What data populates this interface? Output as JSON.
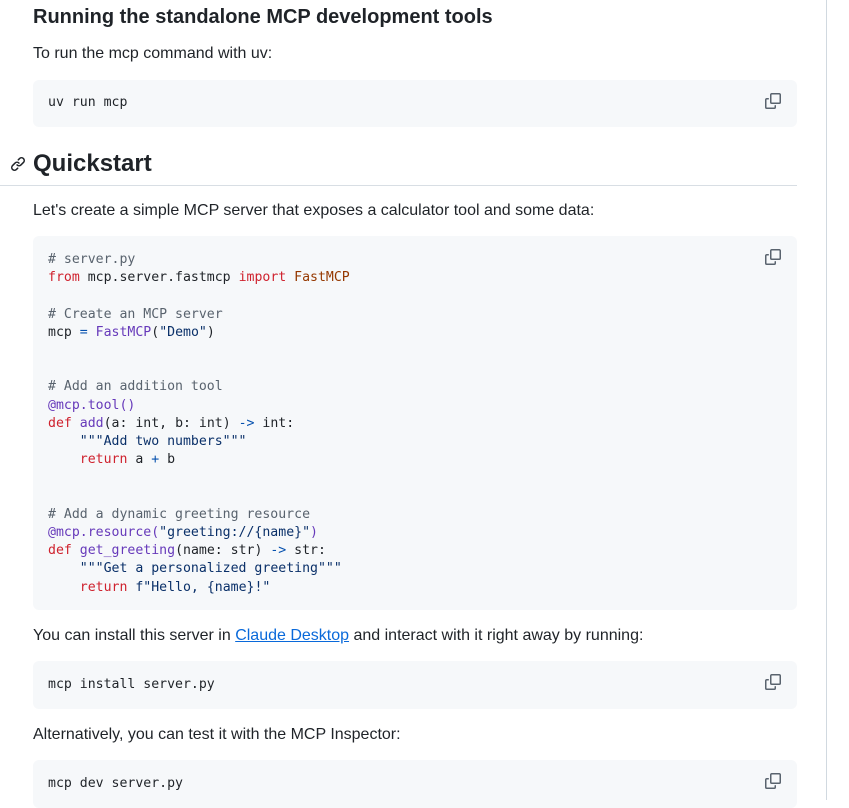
{
  "section_run_tools": {
    "heading": "Running the standalone MCP development tools",
    "intro": "To run the mcp command with uv:",
    "command": "uv run mcp"
  },
  "quickstart": {
    "heading": "Quickstart",
    "intro": "Let's create a simple MCP server that exposes a calculator tool and some data:",
    "code_lines": {
      "l1": "# server.py",
      "l2_from": "from",
      "l2_mod": " mcp.server.fastmcp ",
      "l2_import": "import",
      "l2_cls": " FastMCP",
      "l4": "# Create an MCP server",
      "l5_var": "mcp ",
      "l5_eq": "=",
      "l5_sp": " ",
      "l5_cls": "FastMCP",
      "l5_open": "(",
      "l5_str": "\"Demo\"",
      "l5_close": ")",
      "l8": "# Add an addition tool",
      "l9_deco": "@mcp.tool()",
      "l10_def": "def",
      "l10_sp": " ",
      "l10_name": "add",
      "l10_args": "(a: int, b: int) ",
      "l10_arrow": "->",
      "l10_ret": " int:",
      "l11_indent": "    ",
      "l11_doc": "\"\"\"Add two numbers\"\"\"",
      "l12_indent": "    ",
      "l12_return": "return",
      "l12_a": " a ",
      "l12_plus": "+",
      "l12_b": " b",
      "l15": "# Add a dynamic greeting resource",
      "l16_deco": "@mcp.resource(",
      "l16_str": "\"greeting://{name}\"",
      "l16_close": ")",
      "l17_def": "def",
      "l17_sp": " ",
      "l17_name": "get_greeting",
      "l17_args": "(name: str) ",
      "l17_arrow": "->",
      "l17_ret": " str:",
      "l18_indent": "    ",
      "l18_doc": "\"\"\"Get a personalized greeting\"\"\"",
      "l19_indent": "    ",
      "l19_return": "return",
      "l19_sp": " ",
      "l19_str": "f\"Hello, {name}!\""
    },
    "install_text_before": "You can install this server in ",
    "install_link": "Claude Desktop",
    "install_text_after": " and interact with it right away by running:",
    "install_command": "mcp install server.py",
    "alt_text": "Alternatively, you can test it with the MCP Inspector:",
    "dev_command": "mcp dev server.py"
  },
  "icons": {
    "copy": "copy-icon",
    "anchor": "link-icon"
  },
  "colors": {
    "code_bg": "#f6f8fa",
    "link": "#0969da",
    "keyword": "#cf222e",
    "comment": "#59636e",
    "string": "#0a3069"
  }
}
